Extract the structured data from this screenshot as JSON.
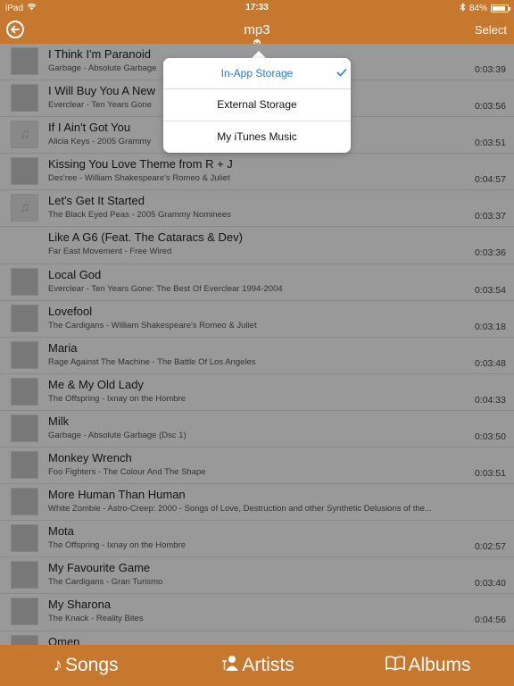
{
  "status_bar": {
    "device": "iPad",
    "time": "17:33",
    "battery": "84%"
  },
  "nav": {
    "title": "mp3",
    "select_label": "Select"
  },
  "songs": [
    {
      "title": "I Think I'm Paranoid",
      "subtitle": "Garbage - Absolute Garbage",
      "duration": "0:03:39",
      "art": "cover"
    },
    {
      "title": "I Will Buy You A New",
      "subtitle": "Everclear - Ten Years Gone",
      "duration": "0:03:56",
      "art": "cover"
    },
    {
      "title": "If I Ain't Got You",
      "subtitle": "Alicia Keys - 2005 Grammy",
      "duration": "0:03:51",
      "art": "generic"
    },
    {
      "title": "Kissing You Love Theme from R + J",
      "subtitle": "Des'ree - William Shakespeare's Romeo & Juliet",
      "duration": "0:04:57",
      "art": "cover"
    },
    {
      "title": "Let's Get It Started",
      "subtitle": "The Black Eyed Peas - 2005 Grammy Nominees",
      "duration": "0:03:37",
      "art": "generic"
    },
    {
      "title": "Like A G6 (Feat. The Cataracs & Dev)",
      "subtitle": "Far East Movement - Free Wired",
      "duration": "0:03:36",
      "art": "blank"
    },
    {
      "title": "Local God",
      "subtitle": "Everclear - Ten Years Gone: The Best Of Everclear 1994-2004",
      "duration": "0:03:54",
      "art": "cover"
    },
    {
      "title": "Lovefool",
      "subtitle": "The Cardigans - William Shakespeare's Romeo & Juliet",
      "duration": "0:03:18",
      "art": "cover"
    },
    {
      "title": "Maria",
      "subtitle": "Rage Against The Machine - The Battle Of Los Angeles",
      "duration": "0:03:48",
      "art": "cover"
    },
    {
      "title": "Me & My Old Lady",
      "subtitle": "The Offspring - Ixnay on the Hombre",
      "duration": "0:04:33",
      "art": "cover"
    },
    {
      "title": "Milk",
      "subtitle": "Garbage - Absolute Garbage (Dsc 1)",
      "duration": "0:03:50",
      "art": "cover"
    },
    {
      "title": "Monkey Wrench",
      "subtitle": "Foo Fighters - The Colour And The Shape",
      "duration": "0:03:51",
      "art": "cover"
    },
    {
      "title": "More Human Than Human",
      "subtitle": "White Zombie - Astro-Creep: 2000 - Songs of Love, Destruction and other Synthetic Delusions of the...",
      "duration": "",
      "art": "cover"
    },
    {
      "title": "Mota",
      "subtitle": "The Offspring - Ixnay on the Hombre",
      "duration": "0:02:57",
      "art": "cover"
    },
    {
      "title": "My Favourite Game",
      "subtitle": "The Cardigans - Gran Turismo",
      "duration": "0:03:40",
      "art": "cover"
    },
    {
      "title": "My Sharona",
      "subtitle": "The Knack - Reality Bites",
      "duration": "0:04:56",
      "art": "cover"
    },
    {
      "title": "Omen",
      "subtitle": "",
      "duration": "",
      "art": "cover"
    }
  ],
  "popover": {
    "items": [
      {
        "label": "In-App Storage",
        "selected": true
      },
      {
        "label": "External Storage",
        "selected": false
      },
      {
        "label": "My iTunes Music",
        "selected": false
      }
    ]
  },
  "tabs": [
    {
      "label": "Songs",
      "icon": "music-note-icon"
    },
    {
      "label": "Artists",
      "icon": "artist-icon"
    },
    {
      "label": "Albums",
      "icon": "book-icon"
    }
  ],
  "colors": {
    "accent": "#c7782f",
    "selected": "#2a7ad9"
  }
}
